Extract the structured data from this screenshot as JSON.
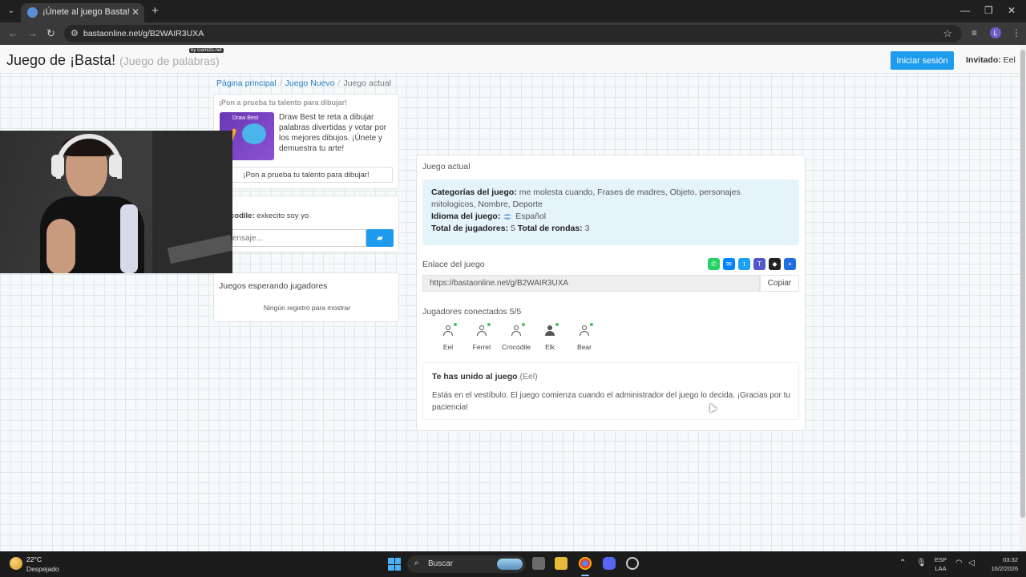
{
  "browser": {
    "tab_title": "¡Únete al juego Basta!",
    "tab_close": "✕",
    "new_tab": "+",
    "url": "bastaonline.net/g/B2WAIR3UXA",
    "profile_initial": "L"
  },
  "header": {
    "brand": "Juego de ¡Basta!",
    "brand_sub": "(Juego de palabras)",
    "gamizo_badge": "by Gamizo.net",
    "login_button": "Iniciar sesión",
    "guest_label": "Invitado:",
    "guest_name": "Eel"
  },
  "breadcrumb": {
    "home": "Página principal",
    "new_game": "Juego Nuevo",
    "current": "Juego actual",
    "separator": "/"
  },
  "promo": {
    "heading": "¡Pon a prueba tu talento para dibujar!",
    "image_title": "Draw Best",
    "text": "Draw Best te reta a dibujar palabras divertidas y votar por los mejores dibujos. ¡Únete y demuestra tu arte!",
    "button": "¡Pon a prueba tu talento para dibujar!"
  },
  "chat": {
    "sender": "codile:",
    "message": "exkecito soy yo",
    "placeholder": "ensaje..."
  },
  "waiting": {
    "title": "Juegos esperando jugadores",
    "empty": "Ningún registro para mostrar"
  },
  "game": {
    "section_label": "Juego actual",
    "categories_label": "Categorías del juego:",
    "categories_line1": "me molesta cuando, Frases de madres, Objeto, personajes",
    "categories_line2": "mitologicos, Nombre, Deporte",
    "language_label": "Idioma del juego:",
    "language": "Español",
    "players_total_label": "Total de jugadores:",
    "players_total": "5",
    "rounds_label": "Total de rondas:",
    "rounds": "3",
    "link_label": "Enlace del juego",
    "link_url": "https://bastaonline.net/g/B2WAIR3UXA",
    "copy_button": "Copiar",
    "players_connected": "Jugadores conectados 5/5",
    "players": [
      {
        "name": "Eel"
      },
      {
        "name": "Ferret"
      },
      {
        "name": "Crocodile"
      },
      {
        "name": "Elk"
      },
      {
        "name": "Bear"
      }
    ],
    "joined_title": "Te has unido al juego",
    "joined_user": "(Eel)",
    "joined_text": "Estás en el vestíbulo. El juego comienza cuando el administrador del juego lo decida. ¡Gracias por tu paciencia!"
  },
  "share_icons": [
    {
      "name": "whatsapp",
      "color": "#25d366",
      "glyph": "✆"
    },
    {
      "name": "messenger",
      "color": "#0084ff",
      "glyph": "✉"
    },
    {
      "name": "twitter",
      "color": "#1da1f2",
      "glyph": "t"
    },
    {
      "name": "teams",
      "color": "#5059c9",
      "glyph": "T"
    },
    {
      "name": "snapchat",
      "color": "#222222",
      "glyph": "◆"
    },
    {
      "name": "add",
      "color": "#1e6fe0",
      "glyph": "+"
    }
  ],
  "taskbar": {
    "temperature": "22°C",
    "weather": "Despejado",
    "search": "Buscar",
    "lang_line1": "ESP",
    "lang_line2": "LAA",
    "time": "03:32",
    "date": "16/2/2026"
  }
}
